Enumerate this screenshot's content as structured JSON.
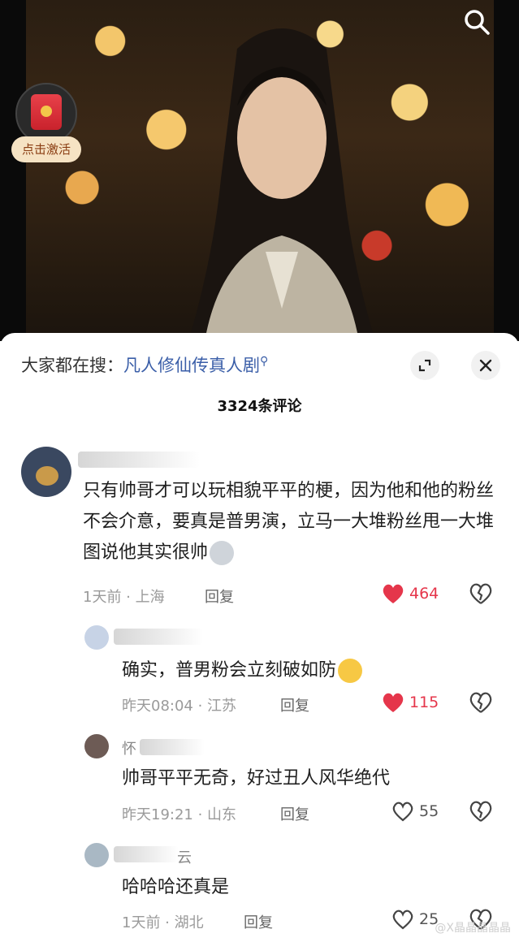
{
  "video": {
    "activate_label": "点击激活"
  },
  "panel": {
    "hot_prefix": "大家都在搜：",
    "hot_keyword": "凡人修仙传真人剧",
    "comment_count": "3324条评论"
  },
  "comments": [
    {
      "text": "只有帅哥才可以玩相貌平平的梗，因为他和他的粉丝不会介意，要真是普男演，立马一大堆粉丝甩一大堆图说他其实很帅",
      "time": "1天前",
      "location": "上海",
      "reply": "回复",
      "likes": "464"
    },
    {
      "text": "确实，普男粉会立刻破如防",
      "time": "昨天08:04",
      "location": "江苏",
      "reply": "回复",
      "likes": "115"
    },
    {
      "name_fragment": "怀",
      "text": "帅哥平平无奇，好过丑人风华绝代",
      "time": "昨天19:21",
      "location": "山东",
      "reply": "回复",
      "likes": "55"
    },
    {
      "name_fragment": "云",
      "text": "哈哈哈还真是",
      "time": "1天前",
      "location": "湖北",
      "reply": "回复",
      "likes": "25"
    }
  ],
  "watermark": "@X晶晶晶晶晶",
  "colors": {
    "like_red": "#e5364b",
    "keyword_blue": "#3a5ea8"
  },
  "icons": [
    "search-icon",
    "red-envelope-icon",
    "magnifier-small-icon",
    "expand-icon",
    "close-icon",
    "heart-icon",
    "broken-heart-icon",
    "husky-emoji-icon",
    "crying-emoji-icon"
  ]
}
